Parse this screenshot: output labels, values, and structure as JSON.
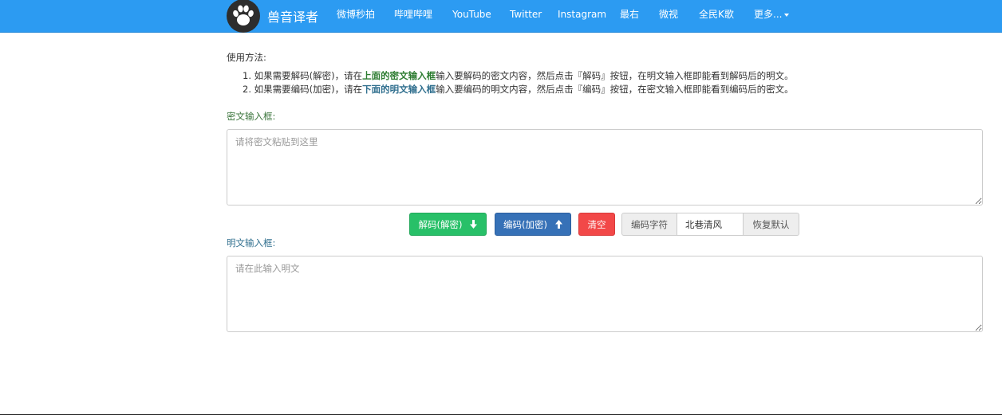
{
  "nav": {
    "brand": "兽音译者",
    "items": [
      "微博秒拍",
      "哔哩哔哩",
      "YouTube",
      "Twitter",
      "Instagram",
      "最右",
      "微视",
      "全民K歌",
      "更多..."
    ]
  },
  "usage": {
    "title": "使用方法:",
    "step1": {
      "prefix": "1. 如果需要解码(解密)，请在",
      "highlight": "上面的密文输入框",
      "suffix": "输入要解码的密文内容，然后点击『解码』按钮，在明文输入框即能看到解码后的明文。"
    },
    "step2": {
      "prefix": "2. 如果需要编码(加密)，请在",
      "highlight": "下面的明文输入框",
      "suffix": "输入要编码的明文内容，然后点击『编码』按钮，在密文输入框即能看到编码后的密文。"
    }
  },
  "cipher": {
    "label": "密文输入框:",
    "placeholder": "请将密文粘贴到这里"
  },
  "plain": {
    "label": "明文输入框:",
    "placeholder": "请在此输入明文"
  },
  "actions": {
    "decode": "解码(解密)",
    "encode": "编码(加密)",
    "clear": "清空",
    "charset_label": "编码字符",
    "charset_value": "北巷清风",
    "reset": "恢复默认"
  },
  "colors": {
    "navbar": "#2c9bf2",
    "decode": "#28c068",
    "encode": "#3671b7",
    "clear": "#f24848"
  }
}
